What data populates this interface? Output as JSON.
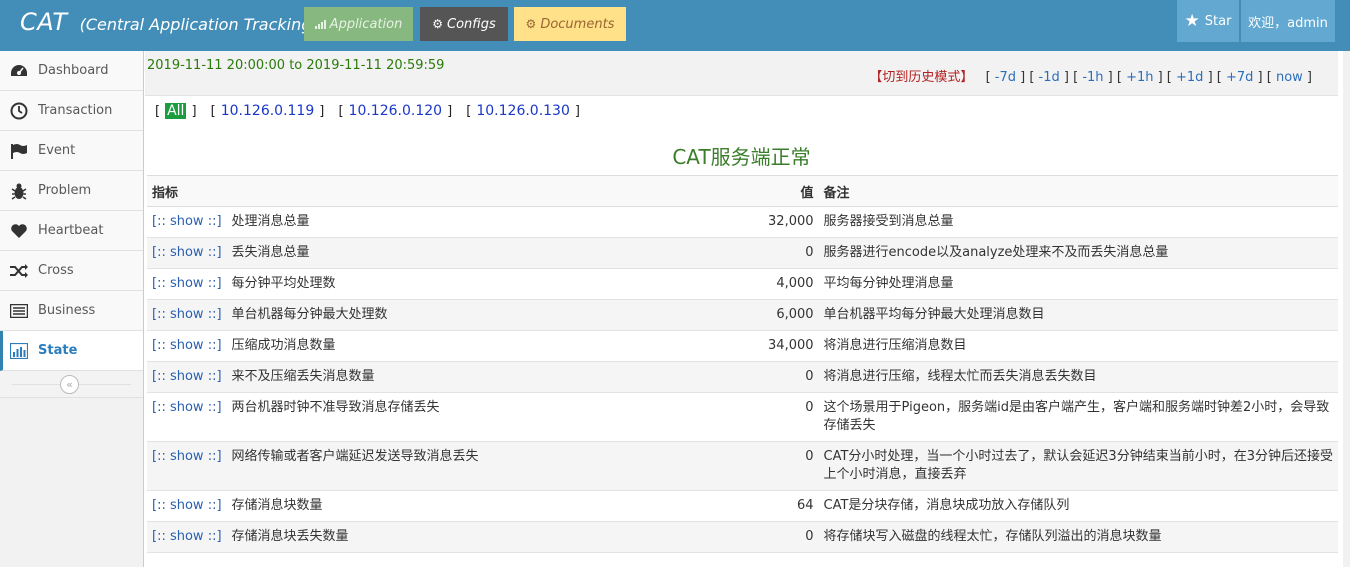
{
  "header": {
    "brand": "CAT",
    "brand_sub": "(Central Application Tracking)",
    "buttons": {
      "application": "Application",
      "configs": "Configs",
      "documents": "Documents"
    },
    "star": "Star",
    "user": "欢迎，admin"
  },
  "sidebar": {
    "items": [
      {
        "label": "Dashboard",
        "icon": "dashboard-icon"
      },
      {
        "label": "Transaction",
        "icon": "clock-icon"
      },
      {
        "label": "Event",
        "icon": "flag-icon"
      },
      {
        "label": "Problem",
        "icon": "bug-icon"
      },
      {
        "label": "Heartbeat",
        "icon": "heart-icon"
      },
      {
        "label": "Cross",
        "icon": "random-icon"
      },
      {
        "label": "Business",
        "icon": "list-icon"
      },
      {
        "label": "State",
        "icon": "bar-chart-icon"
      }
    ],
    "active": "State"
  },
  "timebar": {
    "range": "2019-11-11 20:00:00 to 2019-11-11 20:59:59",
    "history": "【切到历史模式】",
    "links": [
      "-7d",
      "-1d",
      "-1h",
      "+1h",
      "+1d",
      "+7d",
      "now"
    ]
  },
  "ips": {
    "all": "All",
    "list": [
      "10.126.0.119",
      "10.126.0.120",
      "10.126.0.130"
    ]
  },
  "title": "CAT服务端正常",
  "table": {
    "headers": {
      "indicator": "指标",
      "value": "值",
      "note": "备注"
    },
    "show_label": "[:: show ::]",
    "rows": [
      {
        "name": "处理消息总量",
        "value": "32,000",
        "note": "服务器接受到消息总量"
      },
      {
        "name": "丢失消息总量",
        "value": "0",
        "note": "服务器进行encode以及analyze处理来不及而丢失消息总量"
      },
      {
        "name": "每分钟平均处理数",
        "value": "4,000",
        "note": "平均每分钟处理消息量"
      },
      {
        "name": "单台机器每分钟最大处理数",
        "value": "6,000",
        "note": "单台机器平均每分钟最大处理消息数目"
      },
      {
        "name": "压缩成功消息数量",
        "value": "34,000",
        "note": "将消息进行压缩消息数目"
      },
      {
        "name": "来不及压缩丢失消息数量",
        "value": "0",
        "note": "将消息进行压缩，线程太忙而丢失消息丢失数目"
      },
      {
        "name": "两台机器时钟不准导致消息存储丢失",
        "value": "0",
        "note": "这个场景用于Pigeon，服务端id是由客户端产生，客户端和服务端时钟差2小时，会导致存储丢失"
      },
      {
        "name": "网络传输或者客户端延迟发送导致消息丢失",
        "value": "0",
        "note": "CAT分小时处理，当一个小时过去了，默认会延迟3分钟结束当前小时，在3分钟后还接受上个小时消息，直接丢弃"
      },
      {
        "name": "存储消息块数量",
        "value": "64",
        "note": "CAT是分块存储，消息块成功放入存储队列"
      },
      {
        "name": "存储消息块丢失数量",
        "value": "0",
        "note": "将存储块写入磁盘的线程太忙，存储队列溢出的消息块数量"
      }
    ]
  }
}
